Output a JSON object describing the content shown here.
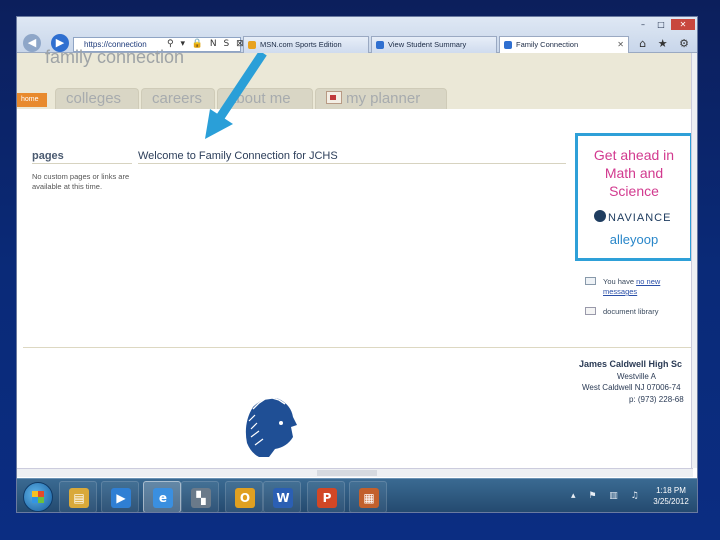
{
  "browser": {
    "address": "https://connection",
    "tabs": [
      {
        "label": "MSN.com Sports Edition",
        "icon_color": "#e8a21f"
      },
      {
        "label": "View Student Summary",
        "icon_color": "#2f6fd0"
      },
      {
        "label": "Family Connection",
        "icon_color": "#2f6fd0"
      }
    ],
    "active_tab": 2,
    "window_buttons": {
      "minimize": "–",
      "maximize": "□",
      "close": "✕"
    },
    "tool_icons": "⌂ ★ ⚙",
    "address_icons": "⚲ ▾ 🔒 N S ⊠"
  },
  "site": {
    "title": "family connection",
    "home_tab": "home",
    "nav_tabs": [
      "colleges",
      "careers",
      "about me",
      "my planner"
    ]
  },
  "main": {
    "pages_heading": "pages",
    "pages_text": "No custom pages or links are available at this time.",
    "welcome": "Welcome to Family Connection for JCHS"
  },
  "ad": {
    "headline": "Get ahead in Math and Science",
    "brand": "NAVIANCE",
    "sub": "alleyoop",
    "border_color": "#2ea0d8",
    "headline_color": "#d23a8f"
  },
  "sidebar": {
    "messages_prefix": "You have ",
    "messages_link": "no new messages",
    "documents_link": "document library"
  },
  "footer": {
    "school_name": "James Caldwell High Sc",
    "line1": "Westville A",
    "line2": "West Caldwell NJ 07006-74",
    "line3": "p: (973) 228-68"
  },
  "taskbar": {
    "items": [
      {
        "name": "explorer-taskbar-item",
        "glyph": "▤",
        "color": "#d9a93a"
      },
      {
        "name": "media-player-taskbar-item",
        "glyph": "▶",
        "color": "#2f7fd4"
      },
      {
        "name": "internet-explorer-taskbar-item",
        "glyph": "e",
        "color": "#3a8fe0"
      },
      {
        "name": "app-taskbar-item",
        "glyph": "▚",
        "color": "#6a7a8a"
      },
      {
        "name": "outlook-taskbar-item",
        "glyph": "O",
        "color": "#e0a021"
      },
      {
        "name": "word-taskbar-item",
        "glyph": "W",
        "color": "#2b5fb4"
      },
      {
        "name": "powerpoint-taskbar-item",
        "glyph": "P",
        "color": "#d24726"
      },
      {
        "name": "publisher-taskbar-item",
        "glyph": "▦",
        "color": "#c2602c"
      }
    ],
    "tray": "▴ ⚑ ▥ ♫",
    "time": "1:18 PM",
    "date": "3/25/2012"
  }
}
